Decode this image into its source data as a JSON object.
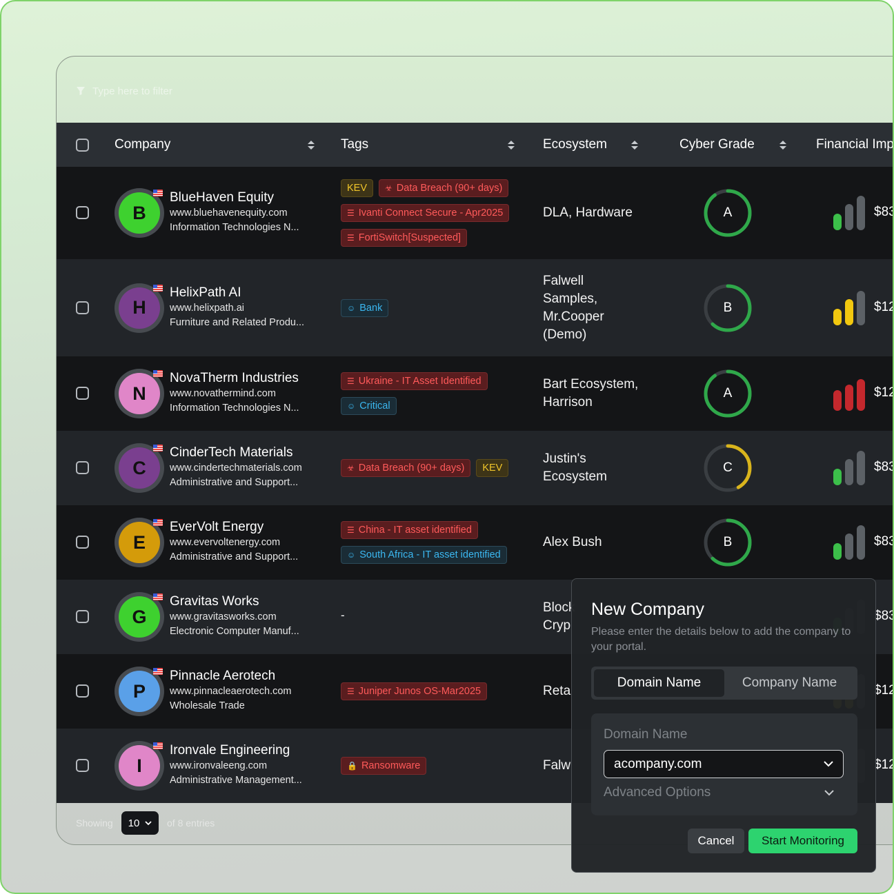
{
  "filter": {
    "placeholder": "Type here to filter"
  },
  "columns": {
    "company": "Company",
    "tags": "Tags",
    "ecosystem": "Ecosystem",
    "cyber_grade": "Cyber Grade",
    "financial": "Financial Imp"
  },
  "rows": [
    {
      "initial": "B",
      "avatar_color": "#3ed12f",
      "name": "BlueHaven Equity",
      "url": "www.bluehavenequity.com",
      "industry": "Information Technologies N...",
      "tags": [
        [
          {
            "label": "KEV",
            "style": "kev",
            "icon": ""
          },
          {
            "label": "Data Breach (90+ days)",
            "style": "red",
            "icon": "biohazard-icon"
          }
        ],
        [
          {
            "label": "Ivanti Connect Secure - Apr2025",
            "style": "red",
            "icon": "server-icon"
          }
        ],
        [
          {
            "label": "FortiSwitch[Suspected]",
            "style": "red",
            "icon": "server-icon"
          }
        ]
      ],
      "ecosystem": [
        "DLA, Hardware"
      ],
      "grade": "A",
      "grade_progress": 0.9,
      "grade_color": "#2fa84a",
      "fin_level": "low",
      "fin_value": "$83"
    },
    {
      "initial": "H",
      "avatar_color": "#7a3f8f",
      "name": "HelixPath AI",
      "url": "www.helixpath.ai",
      "industry": "Furniture and Related Produ...",
      "tags": [
        [
          {
            "label": "Bank",
            "style": "blue",
            "icon": "user-icon"
          }
        ]
      ],
      "ecosystem": [
        "Falwell",
        "Samples,",
        "Mr.Cooper",
        "(Demo)"
      ],
      "grade": "B",
      "grade_progress": 0.62,
      "grade_color": "#2fa84a",
      "fin_level": "medium",
      "fin_value": "$12"
    },
    {
      "initial": "N",
      "avatar_color": "#e086c8",
      "name": "NovaTherm Industries",
      "url": "www.novathermind.com",
      "industry": "Information Technologies N...",
      "tags": [
        [
          {
            "label": "Ukraine - IT Asset Identified",
            "style": "red",
            "icon": "server-icon"
          }
        ],
        [
          {
            "label": "Critical",
            "style": "blue",
            "icon": "user-icon"
          }
        ]
      ],
      "ecosystem": [
        "Bart Ecosystem,",
        "Harrison"
      ],
      "grade": "A",
      "grade_progress": 0.9,
      "grade_color": "#2fa84a",
      "fin_level": "high",
      "fin_value": "$12"
    },
    {
      "initial": "C",
      "avatar_color": "#7a3f8f",
      "name": "CinderTech Materials",
      "url": "www.cindertechmaterials.com",
      "industry": "Administrative and Support...",
      "tags": [
        [
          {
            "label": "Data Breach (90+ days)",
            "style": "red",
            "icon": "biohazard-icon"
          },
          {
            "label": "KEV",
            "style": "kev",
            "icon": ""
          }
        ]
      ],
      "ecosystem": [
        "Justin's",
        "Ecosystem"
      ],
      "grade": "C",
      "grade_progress": 0.42,
      "grade_color": "#d9b41c",
      "fin_level": "low",
      "fin_value": "$83"
    },
    {
      "initial": "E",
      "avatar_color": "#d49b0a",
      "name": "EverVolt Energy",
      "url": "www.evervoltenergy.com",
      "industry": "Administrative and Support...",
      "tags": [
        [
          {
            "label": "China - IT asset identified",
            "style": "red",
            "icon": "server-icon"
          }
        ],
        [
          {
            "label": "South Africa - IT asset identified",
            "style": "blue",
            "icon": "user-icon"
          }
        ]
      ],
      "ecosystem": [
        "Alex Bush"
      ],
      "grade": "B",
      "grade_progress": 0.62,
      "grade_color": "#2fa84a",
      "fin_level": "low",
      "fin_value": "$83"
    },
    {
      "initial": "G",
      "avatar_color": "#3ed12f",
      "name": "Gravitas Works",
      "url": "www.gravitasworks.com",
      "industry": "Electronic Computer Manuf...",
      "tags": [],
      "tags_empty": "-",
      "ecosystem": [
        "Block",
        "Cryp"
      ],
      "grade": "",
      "grade_progress": 0,
      "grade_color": "#2fa84a",
      "fin_level": "low",
      "fin_value": "$83"
    },
    {
      "initial": "P",
      "avatar_color": "#5aa0e8",
      "name": "Pinnacle Aerotech",
      "url": "www.pinnacleaerotech.com",
      "industry": "Wholesale Trade",
      "tags": [
        [
          {
            "label": "Juniper Junos OS-Mar2025",
            "style": "red",
            "icon": "server-icon"
          }
        ]
      ],
      "ecosystem": [
        "Reta"
      ],
      "grade": "",
      "grade_progress": 0,
      "grade_color": "#2fa84a",
      "fin_level": "medium",
      "fin_value": "$12"
    },
    {
      "initial": "I",
      "avatar_color": "#e086c8",
      "name": "Ironvale Engineering",
      "url": "www.ironvaleeng.com",
      "industry": "Administrative Management...",
      "tags": [
        [
          {
            "label": "Ransomware",
            "style": "red",
            "icon": "lock-icon"
          }
        ]
      ],
      "ecosystem": [
        "Falw"
      ],
      "grade": "",
      "grade_progress": 0,
      "grade_color": "#2fa84a",
      "fin_level": "medium",
      "fin_value": "$12"
    }
  ],
  "footer": {
    "showing": "Showing",
    "page_size": "10",
    "of": "of 8 entries"
  },
  "modal": {
    "title": "New Company",
    "subtitle": "Please enter the details below to add the company to your portal.",
    "tab_domain": "Domain Name",
    "tab_company": "Company Name",
    "field_label": "Domain Name",
    "field_value": "acompany.com",
    "advanced": "Advanced Options",
    "cancel": "Cancel",
    "start": "Start Monitoring"
  },
  "colors": {
    "bar_green": "#3cbf4a",
    "bar_gray": "#5c6166",
    "bar_yellow": "#f2c80f",
    "bar_red": "#c4282d",
    "accent": "#2dd36f"
  }
}
